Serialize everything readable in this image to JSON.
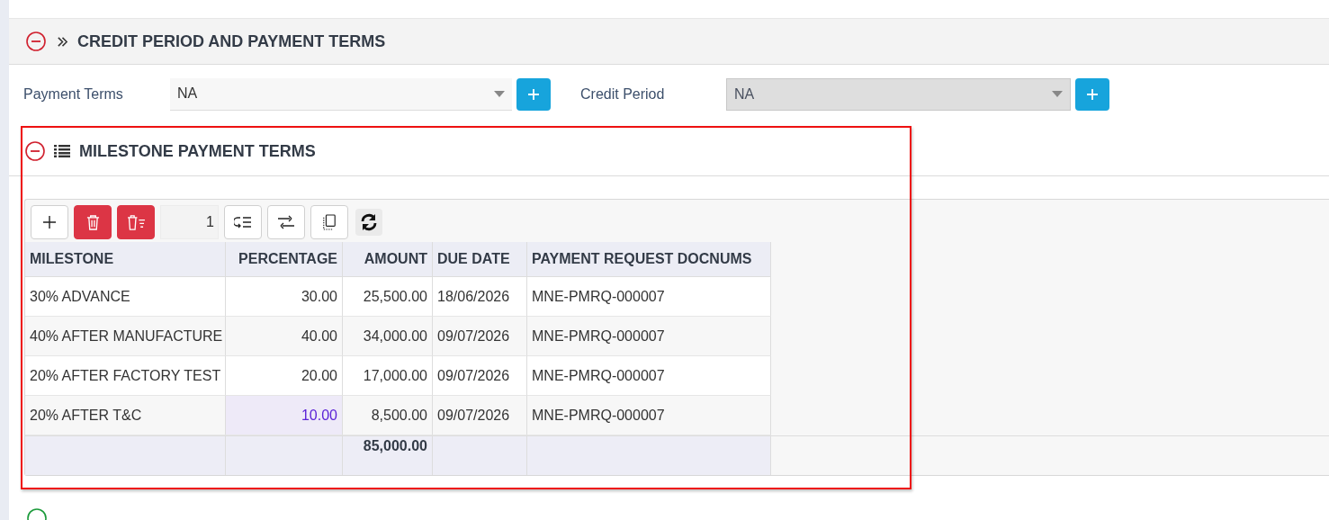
{
  "credit_section": {
    "title": "CREDIT PERIOD AND PAYMENT TERMS",
    "expanded": true
  },
  "fields": [
    {
      "label": "Payment Terms",
      "value": "NA",
      "disabled": false
    },
    {
      "label": "Credit Period",
      "value": "NA",
      "disabled": true
    }
  ],
  "milestone_section": {
    "title": "MILESTONE PAYMENT TERMS",
    "expanded": true
  },
  "toolbar": {
    "page_value": "1"
  },
  "table": {
    "columns": [
      "MILESTONE",
      "PERCENTAGE",
      "AMOUNT",
      "DUE DATE",
      "PAYMENT REQUEST DOCNUMS"
    ],
    "rows": [
      {
        "cells": [
          "30% ADVANCE",
          "30.00",
          "25,500.00",
          "18/06/2026",
          "MNE-PMRQ-000007"
        ],
        "edited_cell": false
      },
      {
        "cells": [
          "40% AFTER MANUFACTURE",
          "40.00",
          "34,000.00",
          "09/07/2026",
          "MNE-PMRQ-000007"
        ],
        "edited_cell": false
      },
      {
        "cells": [
          "20% AFTER FACTORY TEST",
          "20.00",
          "17,000.00",
          "09/07/2026",
          "MNE-PMRQ-000007"
        ],
        "edited_cell": false
      },
      {
        "cells": [
          "20% AFTER T&C",
          "10.00",
          "8,500.00",
          "09/07/2026",
          "MNE-PMRQ-000007"
        ],
        "edited_cell": true
      }
    ],
    "total_amount": "85,000.00"
  }
}
